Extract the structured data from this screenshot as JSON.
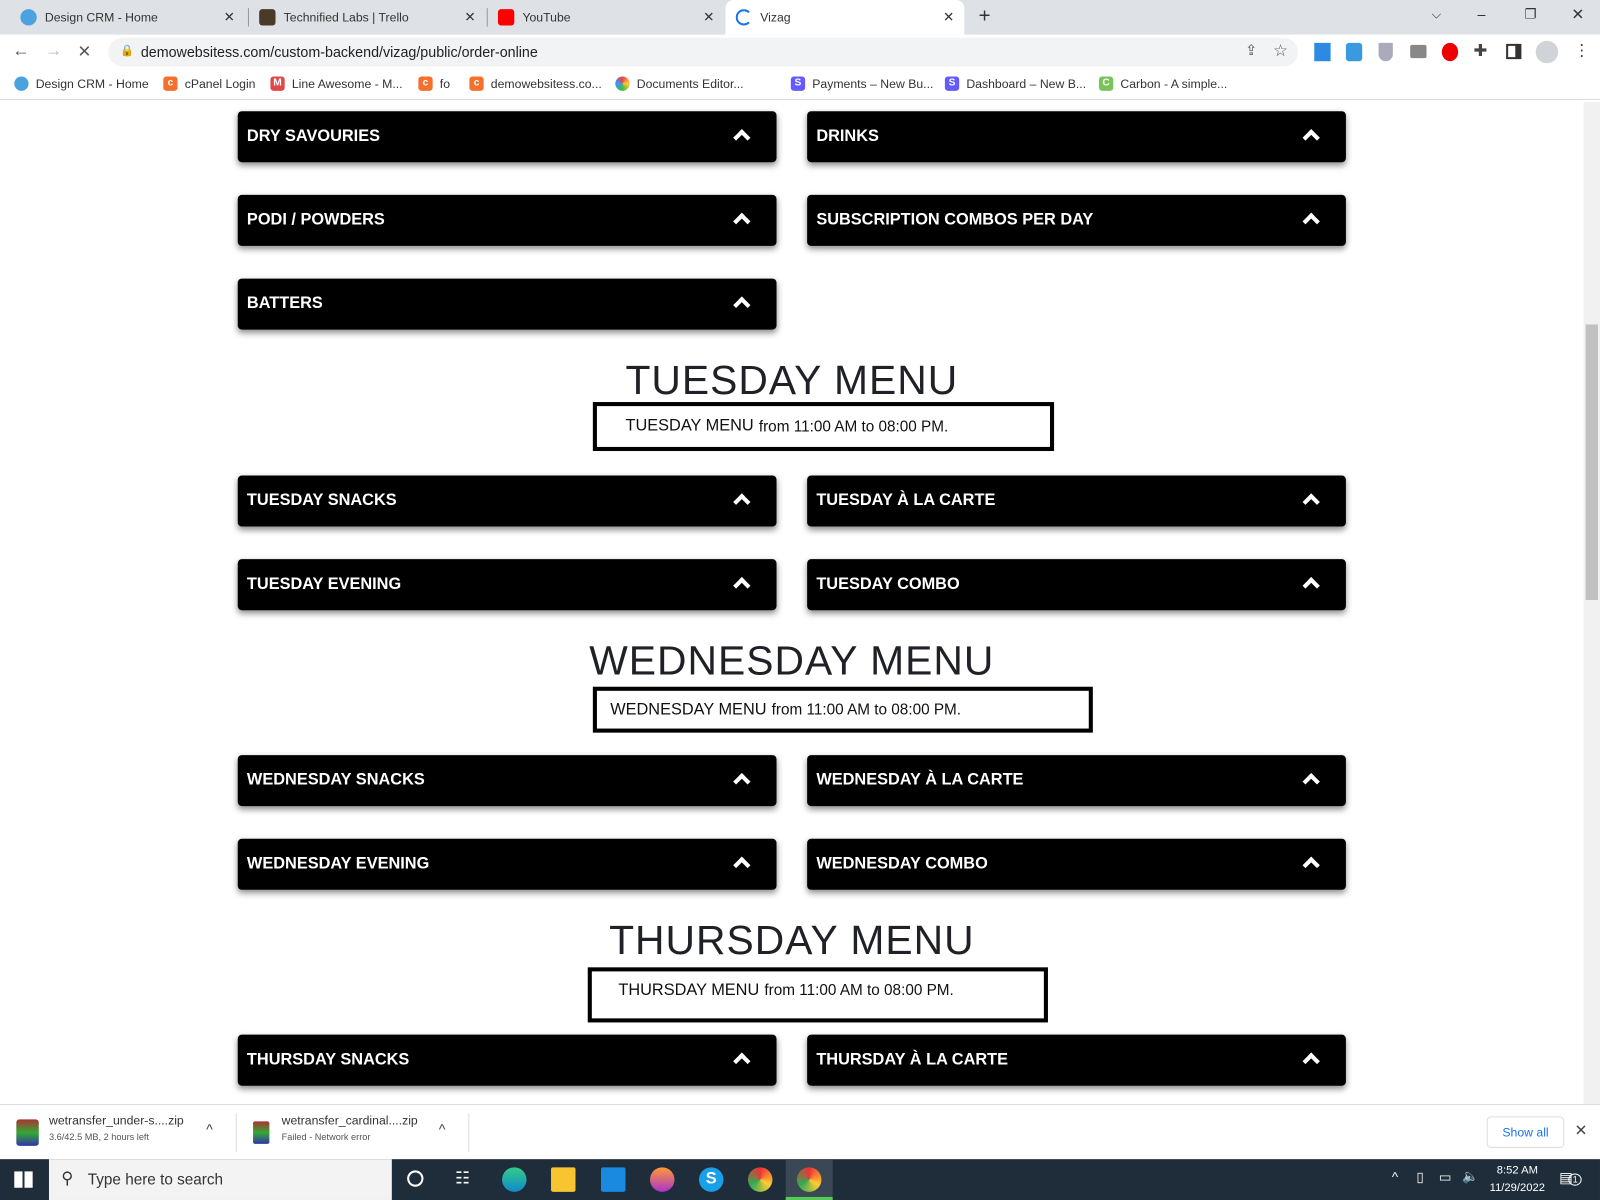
{
  "browser": {
    "tabs": [
      {
        "label": "Design CRM - Home"
      },
      {
        "label": "Technified Labs | Trello"
      },
      {
        "label": "YouTube"
      },
      {
        "label": "Vizag",
        "active": true
      }
    ],
    "url": "demowebsitess.com/custom-backend/vizag/public/order-online",
    "bookmarks": [
      "Design CRM - Home",
      "cPanel Login",
      "Line Awesome - M...",
      "fo",
      "demowebsitess.co...",
      "Documents Editor...",
      "Payments – New Bu...",
      "Dashboard – New B...",
      "Carbon - A simple..."
    ]
  },
  "page": {
    "top_categories": [
      "DRY SAVOURIES",
      "DRINKS",
      "PODI / POWDERS",
      "SUBSCRIPTION COMBOS PER DAY",
      "BATTERS"
    ],
    "sections": [
      {
        "title": "TUESDAY MENU",
        "info_name": "TUESDAY MENU",
        "info_time": "from 11:00 AM to 08:00 PM.",
        "categories": [
          "TUESDAY SNACKS",
          "TUESDAY À LA CARTE",
          "TUESDAY EVENING",
          "TUESDAY COMBO"
        ]
      },
      {
        "title": "WEDNESDAY MENU",
        "info_name": "WEDNESDAY MENU",
        "info_time": "from 11:00 AM to 08:00 PM.",
        "categories": [
          "WEDNESDAY SNACKS",
          "WEDNESDAY À LA CARTE",
          "WEDNESDAY EVENING",
          "WEDNESDAY COMBO"
        ]
      },
      {
        "title": "THURSDAY MENU",
        "info_name": "THURSDAY MENU",
        "info_time": "from 11:00 AM to 08:00 PM.",
        "categories": [
          "THURSDAY SNACKS",
          "THURSDAY À LA CARTE"
        ]
      }
    ]
  },
  "downloads": {
    "items": [
      {
        "name": "wetransfer_under-s....zip",
        "status": "3.6/42.5 MB, 2 hours left"
      },
      {
        "name": "wetransfer_cardinal....zip",
        "status": "Failed - Network error"
      }
    ],
    "show_all": "Show all"
  },
  "taskbar": {
    "search_placeholder": "Type here to search",
    "time": "8:52 AM",
    "date": "11/29/2022",
    "notifications": "1"
  }
}
